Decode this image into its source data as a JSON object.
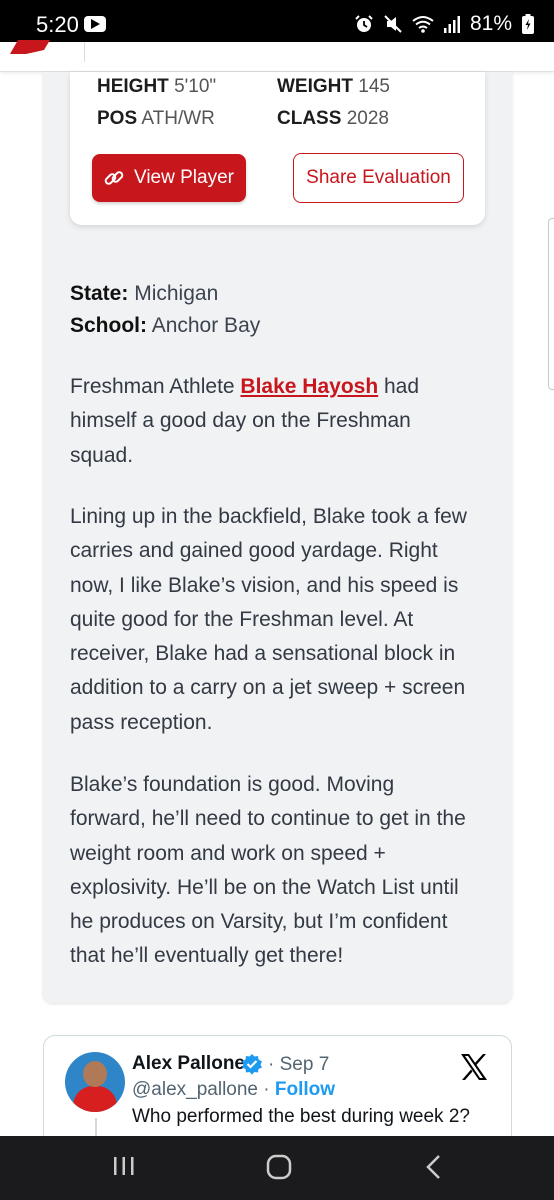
{
  "status_bar": {
    "time": "5:20",
    "battery": "81%",
    "icons": [
      "youtube-icon",
      "alarm-icon",
      "mute-icon",
      "wifi-icon",
      "signal-icon",
      "battery-icon"
    ]
  },
  "player": {
    "height_label": "HEIGHT",
    "height_value": "5'10\"",
    "weight_label": "WEIGHT",
    "weight_value": "145",
    "pos_label": "POS",
    "pos_value": "ATH/WR",
    "class_label": "CLASS",
    "class_value": "2028",
    "view_button": "View Player",
    "share_button": "Share Evaluation"
  },
  "meta": {
    "state_label": "State:",
    "state_value": "Michigan",
    "school_label": "School:",
    "school_value": "Anchor Bay"
  },
  "article": {
    "p1_line1_start": "Freshman Athlete ",
    "p1_link": "Blake Hayosh",
    "p1_line1_end": " had",
    "p1_line2": "himself a good day on the Freshman",
    "p1_line3": "squad.",
    "p2_lines": [
      "Lining up in the backfield, Blake took a few",
      "carries and gained good yardage. Right",
      "now, I like Blake’s vision, and his speed is",
      "quite good for the Freshman level. At",
      "receiver, Blake had a sensational block in",
      "addition to a carry on a jet sweep + screen",
      "pass reception."
    ],
    "p3_lines": [
      "Blake’s foundation is good. Moving",
      "forward, he’ll need to continue to get in the",
      "weight room and work on speed +",
      "explosivity. He’ll be on the Watch List until",
      "he produces on Varsity, but I’m confident",
      "that he’ll eventually get there!"
    ]
  },
  "tweet": {
    "name": "Alex Pallone",
    "date": "· Sep 7",
    "handle": "@alex_pallone · ",
    "follow": "Follow",
    "text": "Who performed the best during week 2?"
  },
  "colors": {
    "brand_red": "#c8161d",
    "card_gray": "#f1f2f4",
    "twitter_blue": "#1d9bf0"
  }
}
